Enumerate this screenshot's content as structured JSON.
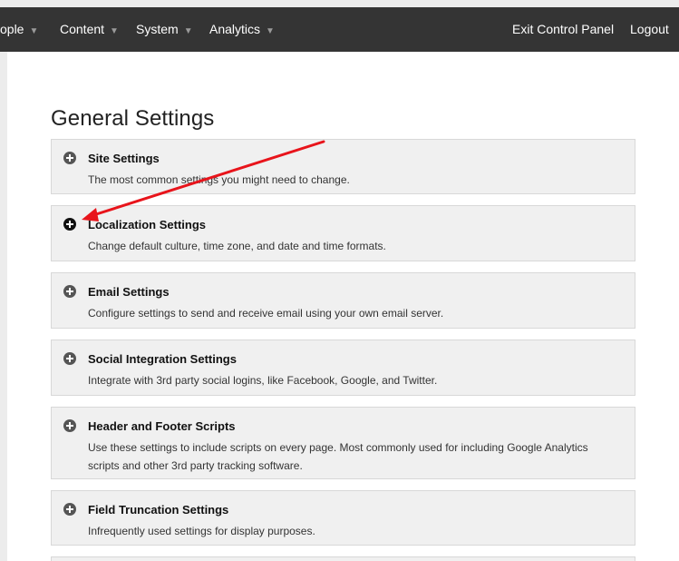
{
  "nav": {
    "left_items": [
      {
        "label": "ople"
      },
      {
        "label": "Content"
      },
      {
        "label": "System"
      },
      {
        "label": "Analytics"
      }
    ],
    "right_items": [
      {
        "label": "Exit Control Panel"
      },
      {
        "label": "Logout"
      }
    ]
  },
  "page": {
    "title": "General Settings"
  },
  "panels": [
    {
      "title": "Site Settings",
      "description": "The most common settings you might need to change."
    },
    {
      "title": "Localization Settings",
      "description": "Change default culture, time zone, and date and time formats."
    },
    {
      "title": "Email Settings",
      "description": "Configure settings to send and receive email using your own email server."
    },
    {
      "title": "Social Integration Settings",
      "description": "Integrate with 3rd party social logins, like Facebook, Google, and Twitter."
    },
    {
      "title": "Header and Footer Scripts",
      "description": "Use these settings to include scripts on every page. Most commonly used for including Google Analytics scripts and other 3rd party tracking software."
    },
    {
      "title": "Field Truncation Settings",
      "description": "Infrequently used settings for display purposes."
    }
  ],
  "colors": {
    "topbar": "#343434",
    "panel_bg": "#f0f0f0",
    "annotation_arrow": "#e8141b"
  }
}
